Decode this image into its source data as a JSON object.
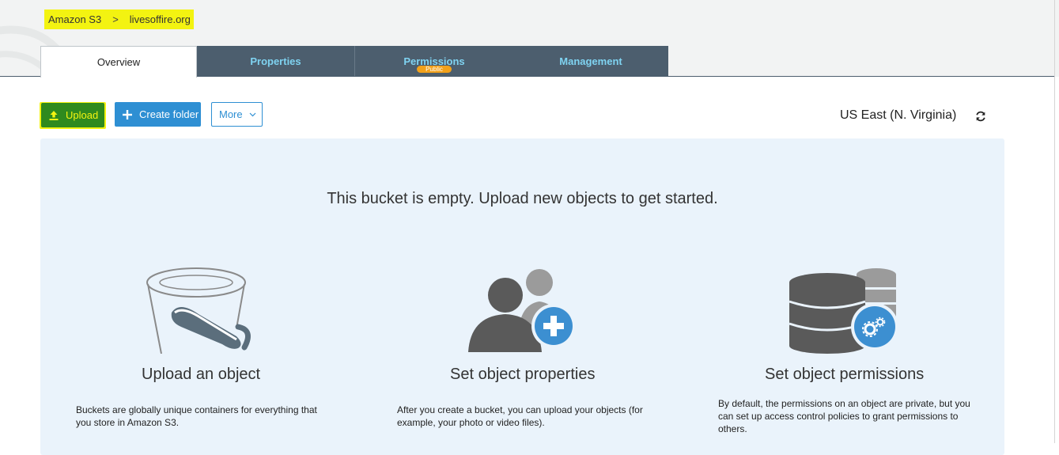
{
  "breadcrumb": {
    "root": "Amazon S3",
    "separator": ">",
    "bucket": "livesoffire.org"
  },
  "tabs": [
    {
      "label": "Overview",
      "active": true
    },
    {
      "label": "Properties",
      "active": false
    },
    {
      "label": "Permissions",
      "active": false,
      "badge": "Public"
    },
    {
      "label": "Management",
      "active": false
    }
  ],
  "toolbar": {
    "upload_label": "Upload",
    "create_folder_label": "Create folder",
    "more_label": "More",
    "region": "US East (N. Virginia)"
  },
  "empty_state": {
    "message": "This bucket is empty. Upload new objects to get started.",
    "cards": [
      {
        "title": "Upload an object",
        "description": "Buckets are globally unique containers for everything that you store in Amazon S3.",
        "icon": "bucket-icon"
      },
      {
        "title": "Set object properties",
        "description": "After you create a bucket, you can upload your objects (for example, your photo or video files).",
        "icon": "users-add-icon"
      },
      {
        "title": "Set object permissions",
        "description": "By default, the permissions on an object are private, but you can set up access control policies to grant permissions to others.",
        "icon": "database-settings-icon"
      }
    ]
  },
  "colors": {
    "tab_bg": "#4c5e6e",
    "tab_text": "#7fd3f1",
    "highlight": "#f3f311",
    "upload_bg": "#2f8a1e",
    "primary": "#2e8fd3",
    "badge": "#f2a11a",
    "panel_bg": "#eaf3fb"
  }
}
